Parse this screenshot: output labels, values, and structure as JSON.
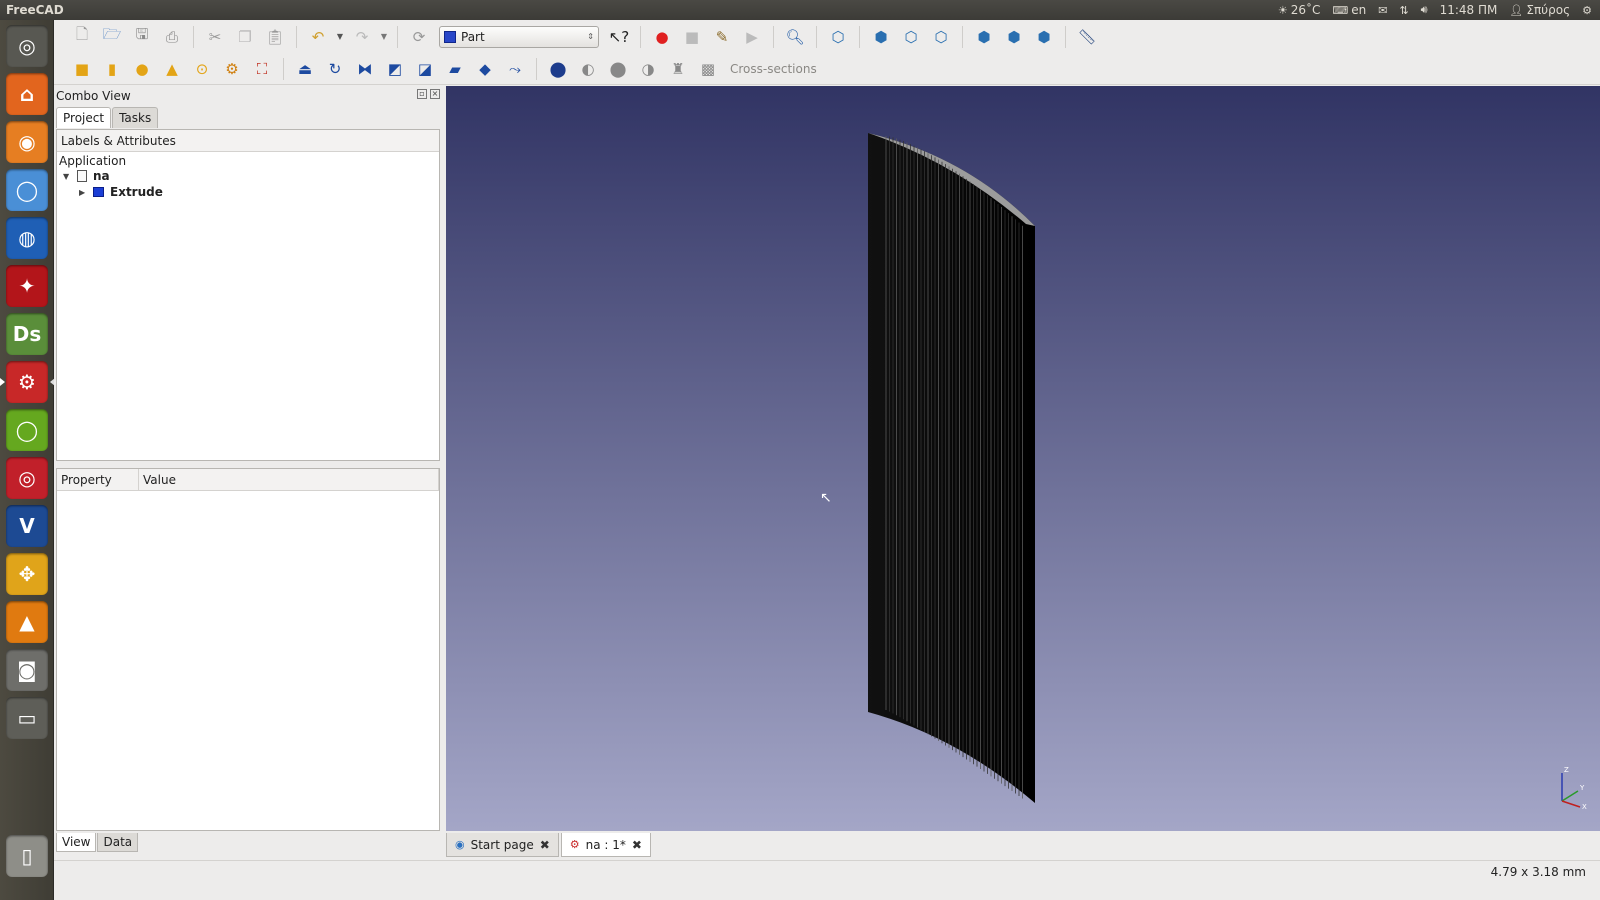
{
  "top_panel": {
    "app_title": "FreeCAD",
    "weather": "26˚C",
    "keyboard": "en",
    "time": "11:48 ΠΜ",
    "user": "Σπύρος",
    "icons": [
      "weather-icon",
      "keyboard-icon",
      "mail-icon",
      "network-icon",
      "volume-icon",
      "user-icon",
      "power-icon"
    ]
  },
  "launcher": {
    "items": [
      {
        "name": "dash-home",
        "glyph": "◎",
        "color": "#585852"
      },
      {
        "name": "files",
        "glyph": "⌂",
        "color": "#e2651e"
      },
      {
        "name": "firefox",
        "glyph": "◉",
        "color": "#e67e22"
      },
      {
        "name": "chromium",
        "glyph": "◯",
        "color": "#4a8fd6"
      },
      {
        "name": "google-earth",
        "glyph": "◍",
        "color": "#1f5fb5"
      },
      {
        "name": "app-red",
        "glyph": "✦",
        "color": "#b3151a"
      },
      {
        "name": "draftsight",
        "glyph": "Ds",
        "color": "#5a8e3a"
      },
      {
        "name": "freecad",
        "glyph": "⚙",
        "color": "#c82828"
      },
      {
        "name": "app-green-ring",
        "glyph": "◯",
        "color": "#65a81f"
      },
      {
        "name": "app-red-circles",
        "glyph": "◎",
        "color": "#c1202a"
      },
      {
        "name": "varicad",
        "glyph": "V",
        "color": "#1d4a93"
      },
      {
        "name": "app-yellow",
        "glyph": "✥",
        "color": "#e0a41a"
      },
      {
        "name": "vlc",
        "glyph": "▲",
        "color": "#e07a10"
      },
      {
        "name": "camera",
        "glyph": "◙",
        "color": "#6e6e6a"
      },
      {
        "name": "workspace",
        "glyph": "▭",
        "color": "#5e5e58"
      },
      {
        "name": "trash",
        "glyph": "▯",
        "color": "#8e8e88"
      }
    ]
  },
  "toolbar1": {
    "workbench": "Part",
    "icons": [
      "new-icon",
      "open-icon",
      "save-icon",
      "print-icon",
      "cut-icon",
      "copy-icon",
      "paste-icon",
      "undo-icon",
      "redo-icon",
      "refresh-icon",
      "whats-this-icon",
      "record-macro-icon",
      "stop-macro-icon",
      "edit-macro-icon",
      "run-macro-icon",
      "fit-all-icon",
      "view-axo-icon",
      "view-front-icon",
      "view-top-icon",
      "view-right-icon",
      "view-rear-icon",
      "view-bottom-icon",
      "view-left-icon",
      "measure-icon"
    ]
  },
  "toolbar2": {
    "icons": [
      "box-icon",
      "cylinder-icon",
      "sphere-icon",
      "cone-icon",
      "torus-icon",
      "primitives-icon",
      "shape-builder-icon",
      "extrude-icon",
      "revolve-icon",
      "mirror-icon",
      "fillet-icon",
      "chamfer-icon",
      "ruled-surface-icon",
      "loft-icon",
      "sweep-icon",
      "boolean-icon",
      "cut-icon",
      "fuse-icon",
      "common-icon",
      "section-icon"
    ],
    "cross_sections": "Cross-sections"
  },
  "combo": {
    "title": "Combo View",
    "tabs": [
      "Project",
      "Tasks"
    ],
    "tree_header": "Labels & Attributes",
    "application": "Application",
    "doc_name": "na",
    "object_name": "Extrude",
    "prop_headers": [
      "Property",
      "Value"
    ],
    "bottom_tabs": [
      "View",
      "Data"
    ]
  },
  "doc_tabs": [
    {
      "label": "Start page"
    },
    {
      "label": "na : 1*"
    }
  ],
  "view3d": {
    "axis_labels": [
      "Z",
      "Y",
      "X"
    ]
  },
  "status": {
    "dimensions": "4.79 x 3.18 mm"
  },
  "colors": {
    "view_top": "#313464",
    "view_bottom": "#a4a6c7",
    "accent_part": "#1b3ed6"
  }
}
